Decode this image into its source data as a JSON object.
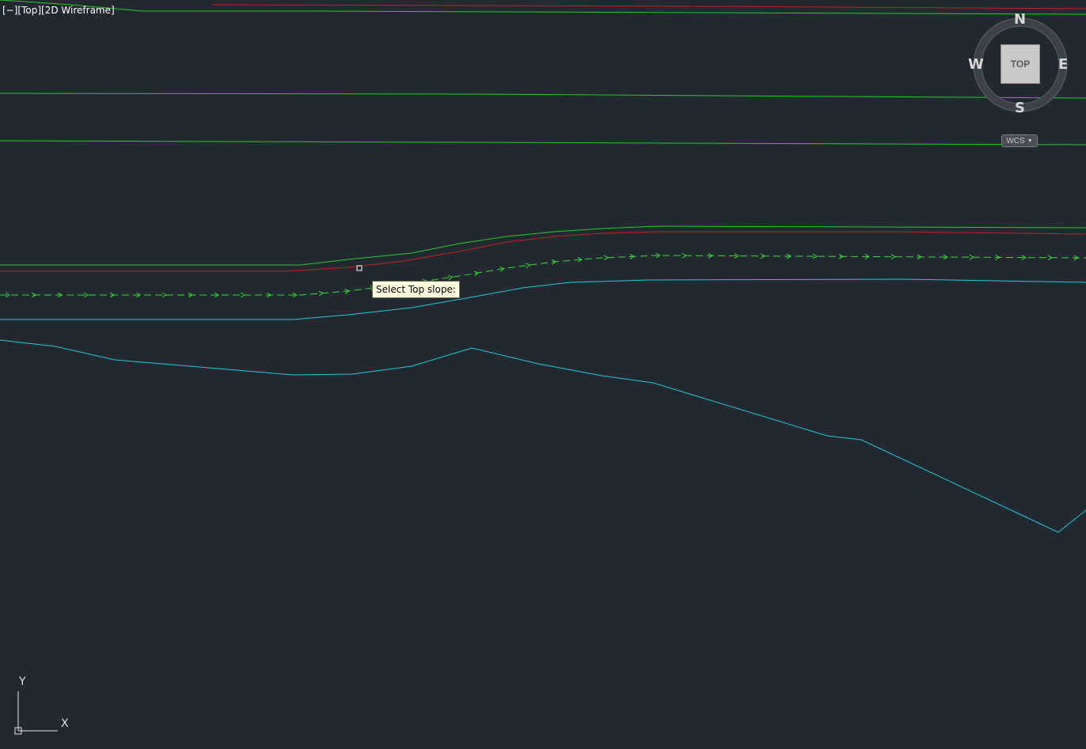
{
  "viewport": {
    "minus_label": "[−]",
    "view_label": "[Top]",
    "style_label": "[2D Wireframe]"
  },
  "tooltip": {
    "text": "Select Top slope:"
  },
  "viewcube": {
    "north": "N",
    "south": "S",
    "east": "E",
    "west": "W",
    "face_label": "TOP",
    "wcs_label": "WCS",
    "wcs_chevron_icon": "chevron-down-icon"
  },
  "ucs": {
    "x_label": "X",
    "y_label": "Y"
  },
  "colors": {
    "background": "#212830",
    "green": "#22cc22",
    "red": "#cc1e1e",
    "cyan": "#1ec8d8",
    "dashed_green": "#33dd33"
  }
}
